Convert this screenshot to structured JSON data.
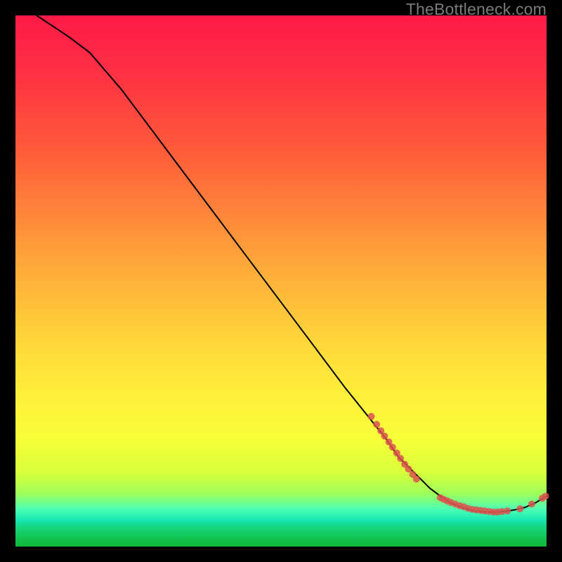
{
  "watermark": "TheBottleneck.com",
  "colors": {
    "gradient_top": "#ff1a47",
    "gradient_mid": "#fff03a",
    "gradient_bottom": "#10b93d",
    "curve": "#000000",
    "dots": "#d9534f",
    "page_bg": "#000000",
    "watermark": "#7a7a7a"
  },
  "chart_data": {
    "type": "line",
    "title": "",
    "xlabel": "",
    "ylabel": "",
    "xlim": [
      0,
      100
    ],
    "ylim": [
      0,
      100
    ],
    "grid": false,
    "legend": false,
    "series": [
      {
        "name": "curve",
        "x": [
          4,
          7,
          10,
          14,
          20,
          26,
          32,
          38,
          44,
          50,
          56,
          62,
          66,
          70,
          72,
          74,
          76,
          78,
          80,
          82,
          84,
          86,
          88,
          90,
          92,
          94,
          96,
          98,
          100
        ],
        "y": [
          100,
          98,
          96,
          93,
          86,
          78,
          70,
          62,
          54,
          46,
          38,
          30,
          25,
          20,
          17,
          15,
          13,
          11,
          9.5,
          8.2,
          7.4,
          6.8,
          6.5,
          6.5,
          6.6,
          6.9,
          7.4,
          8.3,
          9.5
        ]
      }
    ],
    "points": [
      {
        "name": "cluster-a",
        "data": [
          {
            "x": 67,
            "y": 24.5
          },
          {
            "x": 68,
            "y": 23.0
          },
          {
            "x": 68.8,
            "y": 21.8
          },
          {
            "x": 69.5,
            "y": 20.8
          },
          {
            "x": 70.3,
            "y": 19.7
          },
          {
            "x": 71.0,
            "y": 18.7
          },
          {
            "x": 71.8,
            "y": 17.6
          },
          {
            "x": 72.5,
            "y": 16.6
          },
          {
            "x": 73.3,
            "y": 15.5
          },
          {
            "x": 74.0,
            "y": 14.6
          },
          {
            "x": 74.8,
            "y": 13.6
          },
          {
            "x": 75.5,
            "y": 12.7
          }
        ]
      },
      {
        "name": "cluster-b",
        "data": [
          {
            "x": 80.0,
            "y": 9.2
          },
          {
            "x": 80.6,
            "y": 8.9
          },
          {
            "x": 81.3,
            "y": 8.6
          },
          {
            "x": 82.0,
            "y": 8.3
          },
          {
            "x": 82.8,
            "y": 8.0
          },
          {
            "x": 83.6,
            "y": 7.7
          },
          {
            "x": 84.4,
            "y": 7.5
          },
          {
            "x": 85.2,
            "y": 7.2
          },
          {
            "x": 86.0,
            "y": 7.0
          },
          {
            "x": 86.8,
            "y": 6.9
          },
          {
            "x": 87.6,
            "y": 6.8
          },
          {
            "x": 88.4,
            "y": 6.7
          },
          {
            "x": 89.2,
            "y": 6.6
          },
          {
            "x": 90.0,
            "y": 6.5
          },
          {
            "x": 90.8,
            "y": 6.5
          },
          {
            "x": 91.6,
            "y": 6.6
          },
          {
            "x": 92.6,
            "y": 6.7
          }
        ]
      },
      {
        "name": "cluster-c",
        "data": [
          {
            "x": 95.0,
            "y": 7.1
          },
          {
            "x": 97.2,
            "y": 8.0
          },
          {
            "x": 99.2,
            "y": 9.1
          },
          {
            "x": 99.8,
            "y": 9.5
          }
        ]
      }
    ],
    "dot_radius_px": 5
  }
}
